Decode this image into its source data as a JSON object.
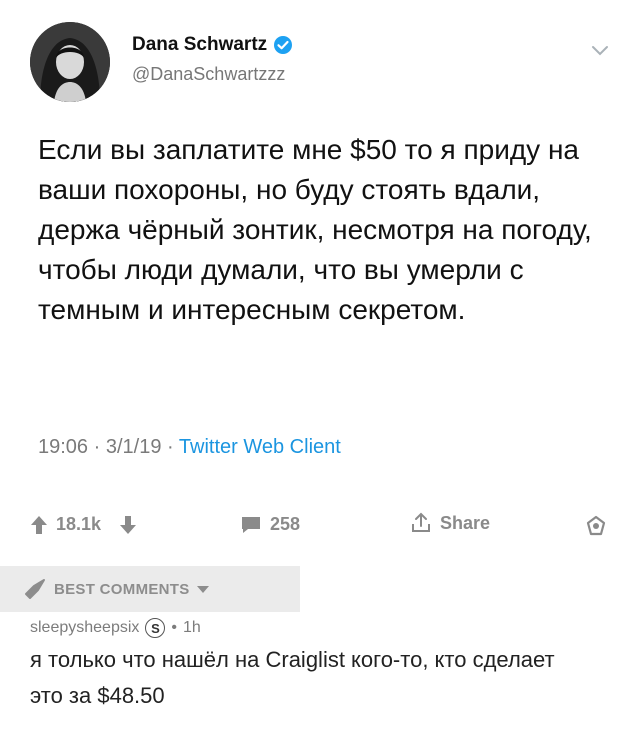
{
  "tweet": {
    "author_name": "Dana Schwartz",
    "author_handle": "@DanaSchwartzzz",
    "text": "Если вы заплатите мне $50 то я приду на ваши похороны, но буду стоять вдали, держа чёрный зонтик, несмотря на погоду, чтобы люди думали, что вы умерли с темным и интересным секретом.",
    "time": "19:06",
    "date": "3/1/19",
    "source": "Twitter Web Client",
    "sep": "·"
  },
  "actions": {
    "upvotes": "18.1k",
    "comments": "258",
    "share_label": "Share"
  },
  "comments": {
    "section_label": "BEST COMMENTS",
    "items": [
      {
        "username": "sleepysheepsix",
        "flair": "S",
        "age": "1h",
        "sep": "•",
        "text": "я только что нашёл на Craiglist кого-то, кто сделает это за $48.50"
      }
    ]
  },
  "colors": {
    "verified": "#1da1f2",
    "gray_icon": "#8a8a8a",
    "best_bar": "#ebebeb"
  }
}
